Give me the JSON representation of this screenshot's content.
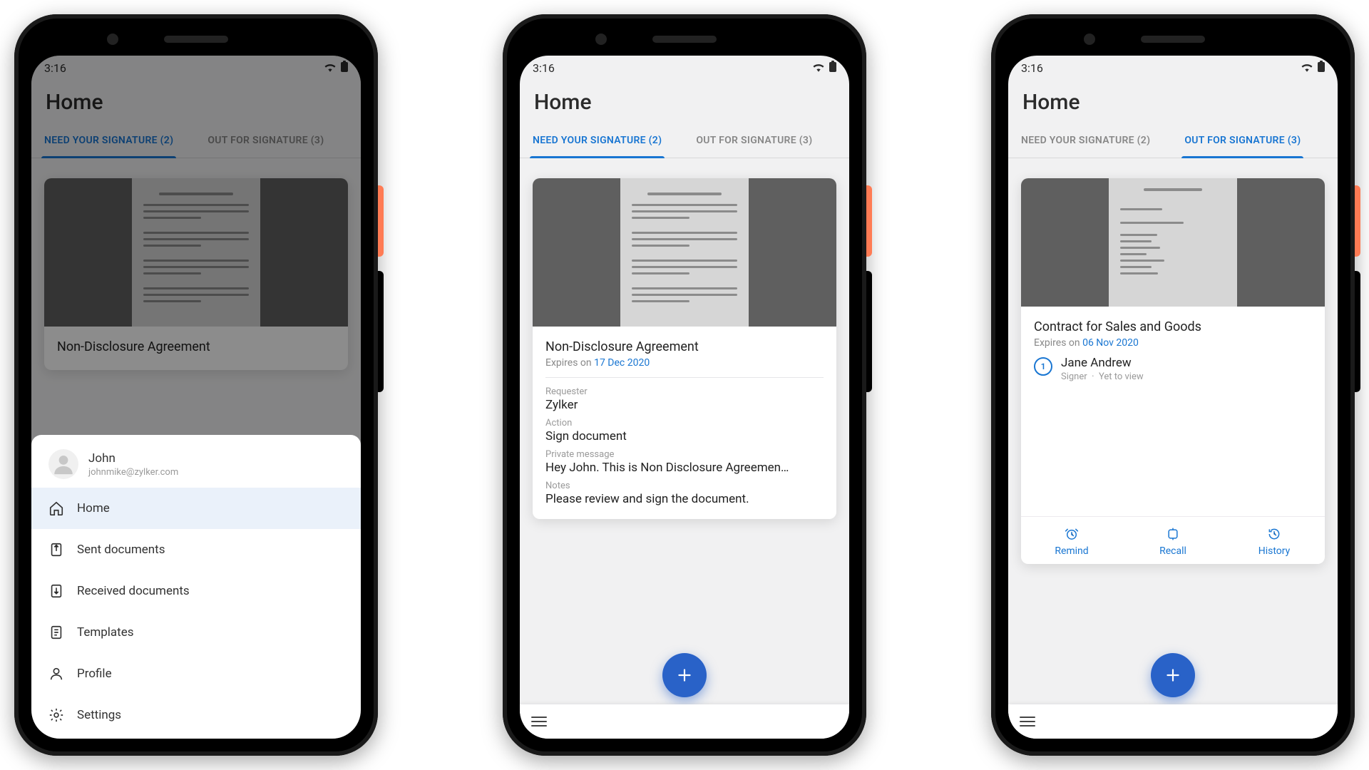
{
  "status": {
    "time": "3:16"
  },
  "header": {
    "title": "Home"
  },
  "tabs": {
    "need_label": "NEED YOUR SIGNATURE (2)",
    "out_label": "OUT FOR SIGNATURE (3)"
  },
  "menu": {
    "user_name": "John",
    "user_email": "johnmike@zylker.com",
    "items": [
      {
        "label": "Home"
      },
      {
        "label": "Sent documents"
      },
      {
        "label": "Received documents"
      },
      {
        "label": "Templates"
      },
      {
        "label": "Profile"
      },
      {
        "label": "Settings"
      }
    ]
  },
  "doc_need": {
    "title": "Non-Disclosure Agreement",
    "expires_prefix": "Expires on ",
    "expires_date": "17 Dec 2020",
    "requester_label": "Requester",
    "requester": "Zylker",
    "action_label": "Action",
    "action": "Sign document",
    "privmsg_label": "Private message",
    "privmsg": "Hey John. This is Non Disclosure Agreemen…",
    "notes_label": "Notes",
    "notes": "Please review and sign the document."
  },
  "doc_out": {
    "title": "Contract for Sales and Goods",
    "expires_prefix": "Expires on ",
    "expires_date": "06 Nov 2020",
    "signer_index": "1",
    "signer_name": "Jane Andrew",
    "signer_role": "Signer",
    "signer_dot": "·",
    "signer_status": "Yet to view",
    "actions": {
      "remind": "Remind",
      "recall": "Recall",
      "history": "History"
    }
  }
}
